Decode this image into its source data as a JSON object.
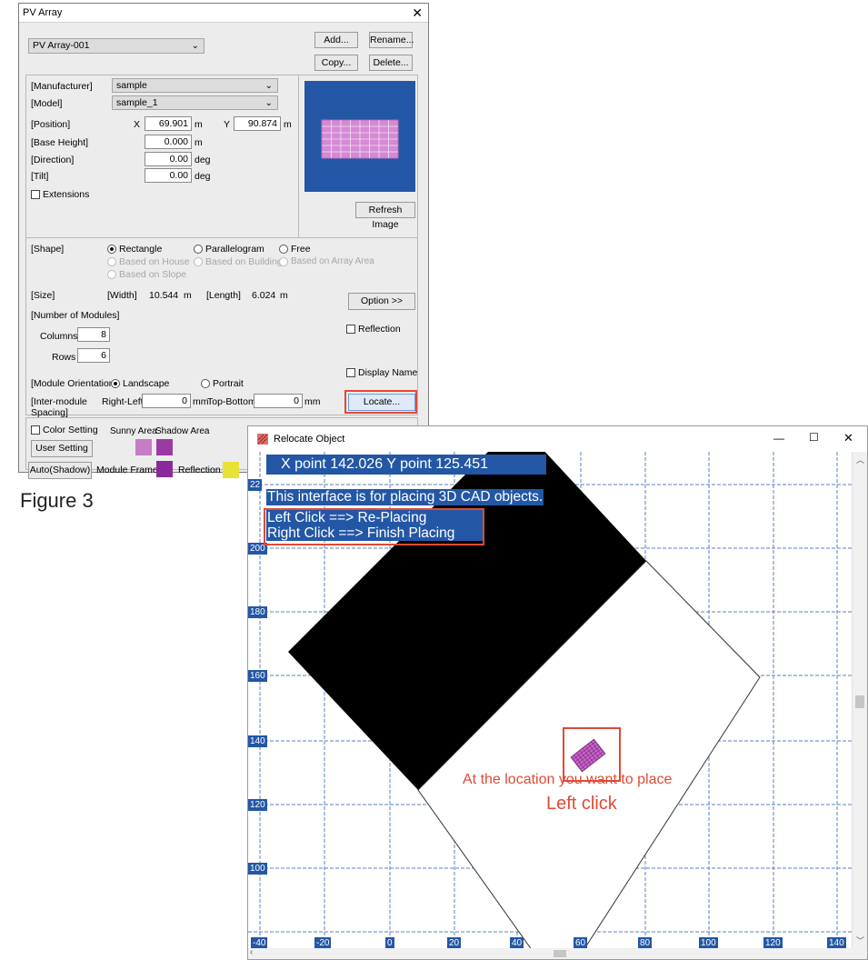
{
  "pv_dialog": {
    "title": "PV Array",
    "array_select": "PV Array-001",
    "buttons": {
      "add": "Add...",
      "rename": "Rename...",
      "copy": "Copy...",
      "delete": "Delete...",
      "refresh_image": "Refresh Image",
      "option": "Option >>",
      "locate": "Locate...",
      "user_setting": "User Setting",
      "auto_shadow": "Auto(Shadow)"
    },
    "manufacturer_label": "[Manufacturer]",
    "manufacturer_value": "sample",
    "model_label": "[Model]",
    "model_value": "sample_1",
    "position_label": "[Position]",
    "x_label": "X",
    "x_value": "69.901",
    "x_unit": "m",
    "y_label": "Y",
    "y_value": "90.874",
    "y_unit": "m",
    "base_height_label": "[Base Height]",
    "base_height_value": "0.000",
    "base_height_unit": "m",
    "direction_label": "[Direction]",
    "direction_value": "0.00",
    "direction_unit": "deg",
    "tilt_label": "[Tilt]",
    "tilt_value": "0.00",
    "tilt_unit": "deg",
    "extensions_label": "Extensions",
    "shape_label": "[Shape]",
    "shape_options": [
      "Rectangle",
      "Parallelogram",
      "Free",
      "Based on House",
      "Based on Building",
      "Based on Array Area",
      "Based on Slope"
    ],
    "size_label": "[Size]",
    "width_label": "[Width]",
    "width_value": "10.544",
    "width_unit": "m",
    "length_label": "[Length]",
    "length_value": "6.024",
    "length_unit": "m",
    "num_modules_label": "[Number of Modules]",
    "columns_label": "Columns",
    "columns_value": "8",
    "rows_label": "Rows",
    "rows_value": "6",
    "reflection_label": "Reflection",
    "display_name_label": "Display Name",
    "orientation_label": "[Module Orientation]",
    "landscape_label": "Landscape",
    "portrait_label": "Portrait",
    "spacing_label_1": "[Inter-module",
    "spacing_label_2": " Spacing]",
    "right_left_label": "Right-Left",
    "right_left_value": "0",
    "right_left_unit": "mm",
    "top_bottom_label": "Top-Bottom",
    "top_bottom_value": "0",
    "top_bottom_unit": "mm",
    "color_setting_label": "Color Setting",
    "sunny_area_label": "Sunny Area",
    "shadow_area_label": "Shadow Area",
    "module_frame_label": "Module Frame",
    "reflection_color_label": "Reflection",
    "colors": {
      "sunny": "#c77cc7",
      "shadow": "#9b3aa5",
      "frame": "#8a2a9a",
      "reflection": "#e8e234",
      "preview_bg": "#2357a6",
      "module": "#d58ad5"
    }
  },
  "figure_label": "Figure 3",
  "relocate": {
    "title": "Relocate Object",
    "coords": "X point 142.026    Y point 125.451",
    "info": "This interface is for placing 3D CAD objects.",
    "left_click": "Left Click ==> Re-Placing",
    "right_click": "Right Click ==> Finish Placing",
    "annotation_1": "At the location you want to place",
    "annotation_2": "Left click",
    "y_ticks": [
      "22",
      "200",
      "180",
      "160",
      "140",
      "120",
      "100"
    ],
    "x_ticks": [
      "-40",
      "-20",
      "0",
      "20",
      "40",
      "60",
      "80",
      "100",
      "120",
      "140"
    ],
    "window_controls": {
      "minimize": "—",
      "maximize": "☐",
      "close": "✕"
    }
  }
}
